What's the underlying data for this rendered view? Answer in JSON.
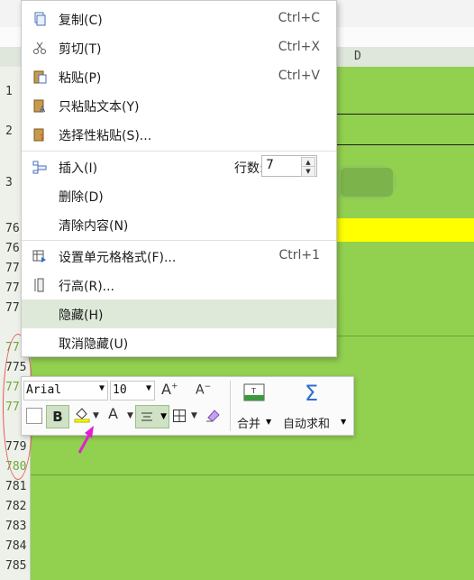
{
  "sheet": {
    "column_label": "D",
    "rows_top": [
      "1",
      "2",
      "3"
    ],
    "rows_mid": [
      "76",
      "76",
      "77",
      "77",
      "77",
      "77"
    ],
    "rows_low": [
      "775",
      "77",
      "77"
    ],
    "row_779": "779",
    "row_780": "780",
    "rows_bottom": [
      "781",
      "782",
      "783",
      "784",
      "785"
    ]
  },
  "context_menu": {
    "items": [
      {
        "label": "复制(C)",
        "shortcut": "Ctrl+C",
        "icon": "copy-icon"
      },
      {
        "label": "剪切(T)",
        "shortcut": "Ctrl+X",
        "icon": "scissors-icon"
      },
      {
        "label": "粘贴(P)",
        "shortcut": "Ctrl+V",
        "icon": "paste-icon"
      },
      {
        "label": "只粘贴文本(Y)",
        "shortcut": "",
        "icon": "paste-text-icon"
      },
      {
        "label": "选择性粘贴(S)...",
        "shortcut": "",
        "icon": "paste-special-icon"
      },
      {
        "label": "插入(I)",
        "shortcut": "",
        "icon": "insert-rows-icon"
      },
      {
        "label": "删除(D)",
        "shortcut": "",
        "icon": ""
      },
      {
        "label": "清除内容(N)",
        "shortcut": "",
        "icon": ""
      },
      {
        "label": "设置单元格格式(F)...",
        "shortcut": "Ctrl+1",
        "icon": "format-cells-icon"
      },
      {
        "label": "行高(R)...",
        "shortcut": "",
        "icon": "row-height-icon"
      },
      {
        "label": "隐藏(H)",
        "shortcut": "",
        "icon": ""
      },
      {
        "label": "取消隐藏(U)",
        "shortcut": "",
        "icon": ""
      }
    ],
    "insert_rows_label": "行数:",
    "insert_rows_value": "7"
  },
  "mini_toolbar": {
    "font_name": "Arial",
    "font_size": "10",
    "grow_font_label": "A",
    "shrink_font_label": "A",
    "bold_label": "B",
    "font_color_label": "A",
    "merge_label": "合并",
    "autosum_label": "自动求和",
    "autosum_symbol": "Σ"
  },
  "colors": {
    "cell_green": "#92d050",
    "highlight_yellow": "#ffff00",
    "annotation_arrow": "#e020d0",
    "annotation_oval": "#e05a5a"
  }
}
